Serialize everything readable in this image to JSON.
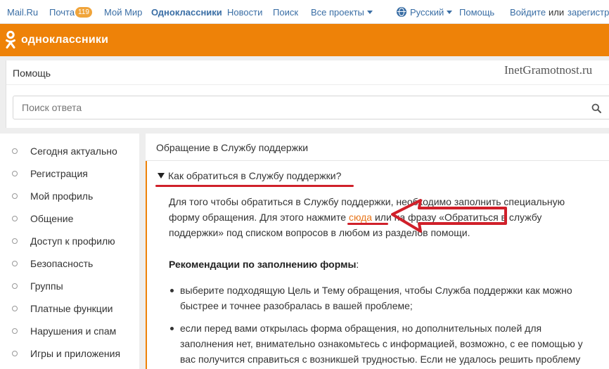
{
  "portal_nav": {
    "mailru": "Mail.Ru",
    "mail": "Почта",
    "mail_count": "119",
    "my_world": "Мой Мир",
    "odnoklassniki": "Одноклассники",
    "news": "Новости",
    "search": "Поиск",
    "all_projects": "Все проекты",
    "language": "Русский",
    "help": "Помощь",
    "login": "Войдите",
    "or": "или",
    "register": "зарегистрируйтесь"
  },
  "header": {
    "logo_text": "одноклассники",
    "brand_color": "#ee8208"
  },
  "help": {
    "title": "Помощь",
    "watermark": "InetGramotnost.ru",
    "search_placeholder": "Поиск ответа"
  },
  "sidebar": {
    "items": [
      {
        "label": "Сегодня актуально"
      },
      {
        "label": "Регистрация"
      },
      {
        "label": "Мой профиль"
      },
      {
        "label": "Общение"
      },
      {
        "label": "Доступ к профилю"
      },
      {
        "label": "Безопасность"
      },
      {
        "label": "Группы"
      },
      {
        "label": "Платные функции"
      },
      {
        "label": "Нарушения и спам"
      },
      {
        "label": "Игры и приложения"
      }
    ]
  },
  "main": {
    "title": "Обращение в Службу поддержки",
    "question": "Как обратиться в Службу поддержки?",
    "para_part1": "Для того чтобы обратиться в Службу поддержки, необходимо заполнить специальную форму обращения. Для этого нажмите ",
    "link_here": "сюда",
    "para_part2": " или на фразу «Обратиться в службу поддержки» под списком вопросов в любом из разделов помощи.",
    "recommendations_title": "Рекомендации по заполнению формы",
    "recommendations_colon": ":",
    "bullets": [
      "выберите подходящую Цель и Тему обращения, чтобы Служба поддержки как можно быстрее и точнее разобралась в вашей проблеме;",
      "если перед вами открылась форма обращения, но дополнительных полей для заполнения нет, внимательно ознакомьтесь с информацией, возможно, с ее помощью у вас получится справиться с возникшей трудностью. Если не удалось решить проблему"
    ]
  },
  "colors": {
    "annotation_red": "#d0202a",
    "link_orange": "#e8751a",
    "link_blue": "#3a6ea5"
  }
}
